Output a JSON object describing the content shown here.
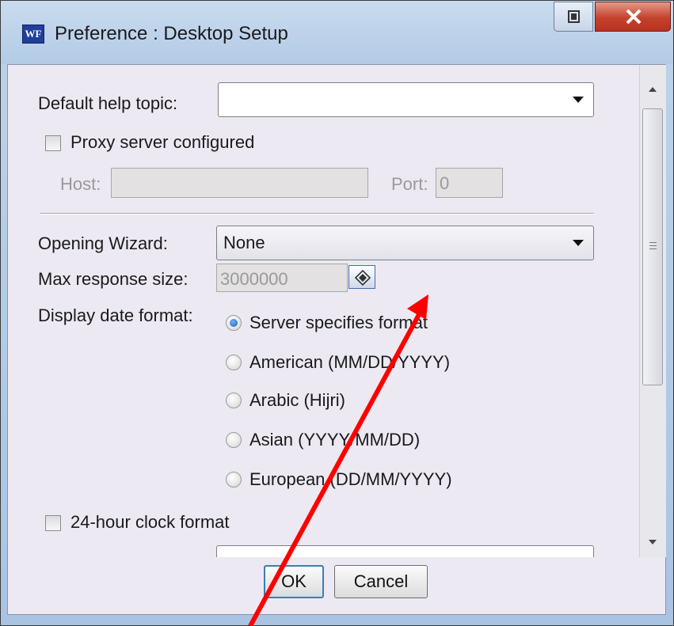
{
  "window": {
    "app_icon": "WF",
    "title": "Preference : Desktop Setup",
    "restore_icon": "restore-icon",
    "close_icon": "close-icon"
  },
  "form": {
    "help_topic": {
      "label": "Default help topic:",
      "value": ""
    },
    "proxy": {
      "label": "Proxy server configured",
      "checked": false
    },
    "host": {
      "label": "Host:",
      "value": ""
    },
    "port": {
      "label": "Port:",
      "value": "0"
    },
    "opening_wizard": {
      "label": "Opening Wizard:",
      "value": "None"
    },
    "max_response": {
      "label": "Max response size:",
      "value": "3000000",
      "button_icon": "lock-icon"
    },
    "date_format": {
      "label": "Display date format:",
      "options": [
        {
          "label": "Server specifies format",
          "selected": true
        },
        {
          "label": "American (MM/DD/YYYY)",
          "selected": false
        },
        {
          "label": "Arabic (Hijri)",
          "selected": false
        },
        {
          "label": "Asian (YYYY/MM/DD)",
          "selected": false
        },
        {
          "label": "European (DD/MM/YYYY)",
          "selected": false
        }
      ]
    },
    "clock_24h": {
      "label": "24-hour clock format",
      "checked": false
    }
  },
  "buttons": {
    "ok": "OK",
    "cancel": "Cancel"
  },
  "annotation": {
    "color": "#ff0000",
    "type": "arrow"
  },
  "colors": {
    "close_button": "#c4412c",
    "accent_radio": "#1d5fb8",
    "client_bg": "#ece9f2"
  }
}
